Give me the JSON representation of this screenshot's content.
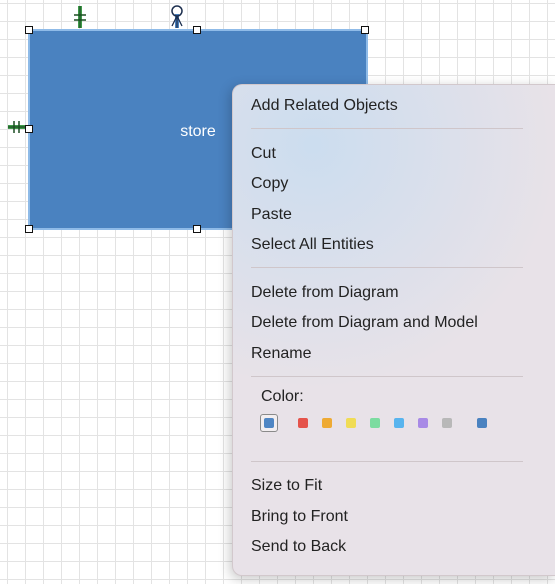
{
  "diagram": {
    "entity_label": "store",
    "entity_color": "#4a82c0"
  },
  "context_menu": {
    "items_group1": [
      "Add Related Objects"
    ],
    "items_group2": [
      "Cut",
      "Copy",
      "Paste",
      "Select All Entities"
    ],
    "items_group3": [
      "Delete from Diagram",
      "Delete from Diagram and Model",
      "Rename"
    ],
    "color_label": "Color:",
    "color_swatches": [
      {
        "name": "blue",
        "hex": "#4f86c4",
        "selected": true
      },
      {
        "name": "red",
        "hex": "#e5534b"
      },
      {
        "name": "orange",
        "hex": "#eeaa33"
      },
      {
        "name": "yellow",
        "hex": "#f0dc55"
      },
      {
        "name": "green",
        "hex": "#7cdca0"
      },
      {
        "name": "light-blue",
        "hex": "#58b4ee"
      },
      {
        "name": "purple",
        "hex": "#a88ae6"
      },
      {
        "name": "gray",
        "hex": "#b8b8b8"
      },
      {
        "name": "steel-blue",
        "hex": "#4a82c0"
      }
    ],
    "items_group4": [
      "Size to Fit",
      "Bring to Front",
      "Send to Back"
    ]
  }
}
